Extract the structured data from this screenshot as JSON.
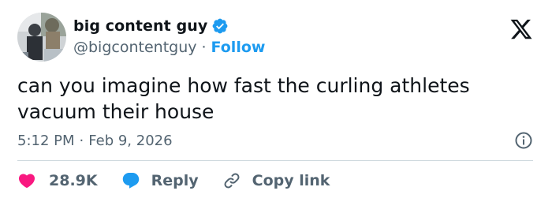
{
  "author": {
    "display_name": "big content guy",
    "handle": "@bigcontentguy",
    "follow_label": "Follow",
    "separator": "·"
  },
  "tweet": {
    "text": "can you imagine how fast the curling athletes\nvacuum their house",
    "time": "5:12 PM",
    "date": "Feb 9, 2026",
    "separator": "·"
  },
  "actions": {
    "likes": "28.9K",
    "reply_label": "Reply",
    "copy_link_label": "Copy link"
  },
  "icons": {
    "brand": "x-logo-icon",
    "verified": "verified-badge-icon",
    "info": "info-icon",
    "like": "heart-icon",
    "reply": "reply-bubble-icon",
    "copy": "link-icon"
  },
  "colors": {
    "accent": "#1d9bf0",
    "like": "#f91880",
    "text": "#0f1419",
    "muted": "#536471",
    "divider": "#cfd9de"
  }
}
